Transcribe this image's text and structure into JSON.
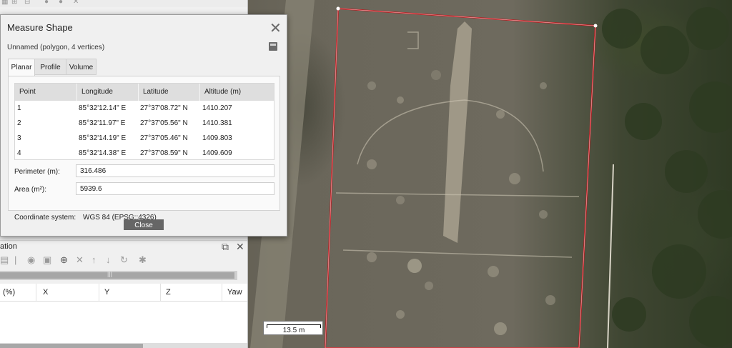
{
  "dialog": {
    "title": "Measure Shape",
    "subtitle": "Unnamed (polygon, 4 vertices)",
    "close_icon": "close-icon",
    "export_icon": "save-icon",
    "tabs": [
      {
        "label": "Planar",
        "active": true
      },
      {
        "label": "Profile",
        "active": false
      },
      {
        "label": "Volume",
        "active": false
      }
    ],
    "table": {
      "columns": [
        "Point",
        "Longitude",
        "Latitude",
        "Altitude (m)"
      ],
      "rows": [
        [
          "1",
          "85°32'12.14\" E",
          "27°37'08.72\" N",
          "1410.207"
        ],
        [
          "2",
          "85°32'11.97\" E",
          "27°37'05.56\" N",
          "1410.381"
        ],
        [
          "3",
          "85°32'14.19\" E",
          "27°37'05.46\" N",
          "1409.803"
        ],
        [
          "4",
          "85°32'14.38\" E",
          "27°37'08.59\" N",
          "1409.609"
        ]
      ]
    },
    "perimeter_label": "Perimeter (m):",
    "perimeter_value": "316.486",
    "area_label": "Area (m²):",
    "area_value": "5939.6",
    "coord_label": "Coordinate system:",
    "coord_value": "WGS 84 (EPSG::4326)",
    "close_button": "Close"
  },
  "dock": {
    "title_fragment": "ation",
    "columns": [
      "(%)",
      "X",
      "Y",
      "Z",
      "Yaw"
    ],
    "float_icon": "float-window-icon",
    "close_icon": "close-icon"
  },
  "scale_bar": {
    "label": "13.5 m"
  },
  "colors": {
    "polygon_outline": "#c4161c",
    "button": "#666666",
    "dialog_bg": "#f0f0f0",
    "table_header": "#dedede"
  }
}
